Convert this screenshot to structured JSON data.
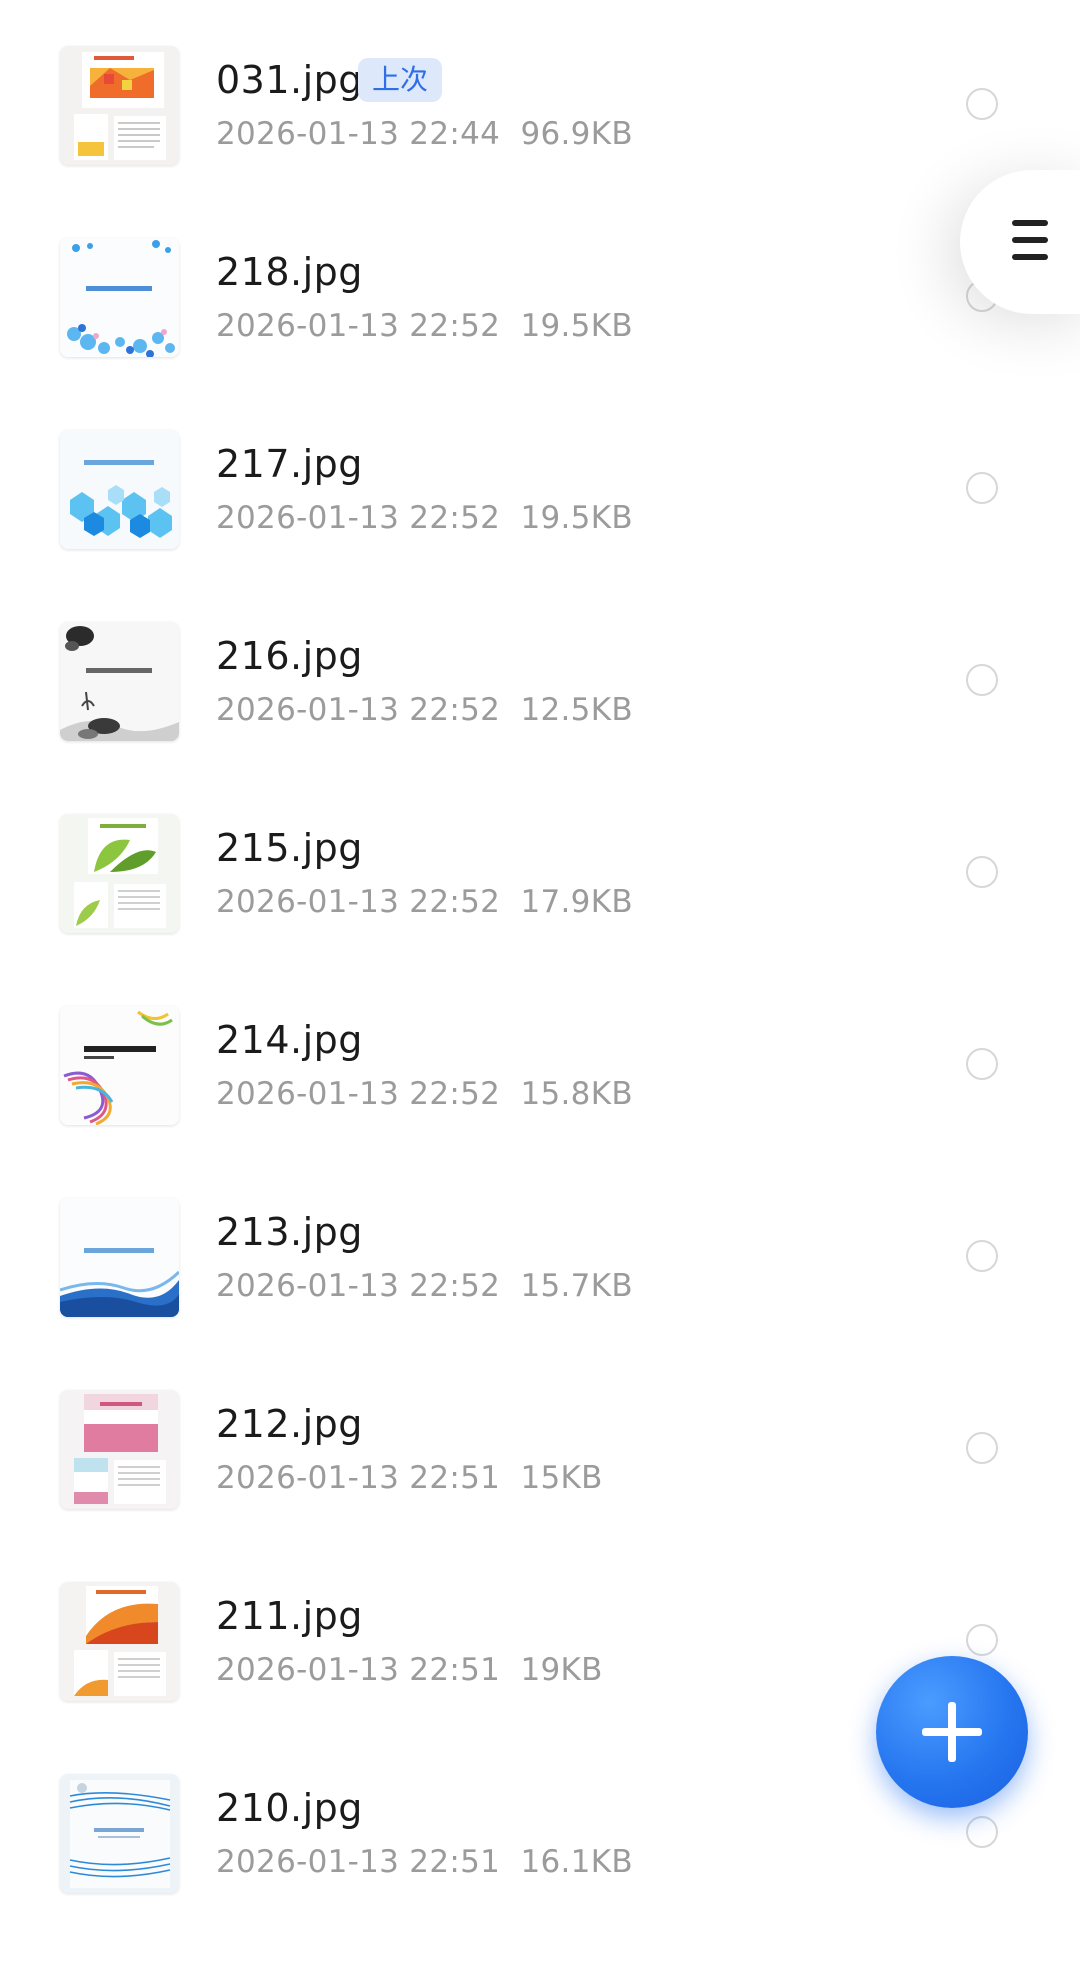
{
  "files": [
    {
      "name": "031.jpg",
      "badge": "上次",
      "date": "2026-01-13 22:44",
      "size": "96.9KB",
      "thumb": "orange-mosaic"
    },
    {
      "name": "218.jpg",
      "date": "2026-01-13 22:52",
      "size": "19.5KB",
      "thumb": "blue-dots"
    },
    {
      "name": "217.jpg",
      "date": "2026-01-13 22:52",
      "size": "19.5KB",
      "thumb": "blue-hex"
    },
    {
      "name": "216.jpg",
      "date": "2026-01-13 22:52",
      "size": "12.5KB",
      "thumb": "ink-wash"
    },
    {
      "name": "215.jpg",
      "date": "2026-01-13 22:52",
      "size": "17.9KB",
      "thumb": "green-leaf"
    },
    {
      "name": "214.jpg",
      "date": "2026-01-13 22:52",
      "size": "15.8KB",
      "thumb": "rainbow-ribbon"
    },
    {
      "name": "213.jpg",
      "date": "2026-01-13 22:52",
      "size": "15.7KB",
      "thumb": "blue-wave"
    },
    {
      "name": "212.jpg",
      "date": "2026-01-13 22:51",
      "size": "15KB",
      "thumb": "pink-cover"
    },
    {
      "name": "211.jpg",
      "date": "2026-01-13 22:51",
      "size": "19KB",
      "thumb": "orange-wave"
    },
    {
      "name": "210.jpg",
      "date": "2026-01-13 22:51",
      "size": "16.1KB",
      "thumb": "blue-lines"
    }
  ],
  "side_menu_icon": "menu-icon",
  "fab_icon": "plus-icon",
  "colors": {
    "accent": "#2676f0",
    "badge_bg": "#dde8fb",
    "badge_text": "#2f6ee6",
    "meta_text": "#9b9b9b"
  }
}
